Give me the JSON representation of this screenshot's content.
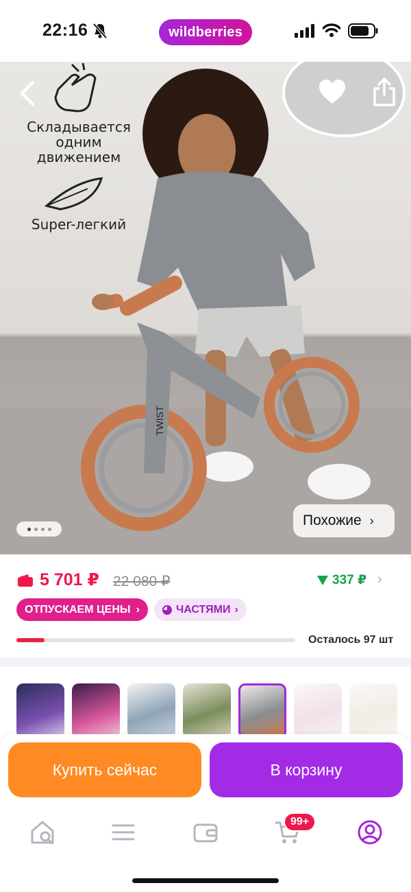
{
  "status_bar": {
    "time": "22:16",
    "brand": "wildberries"
  },
  "hero": {
    "promo_lines": [
      "Складывается",
      "одним",
      "движением",
      "Super-легкий"
    ],
    "frame_lettering": "TWIST",
    "similar_label": "Похожие",
    "pager": {
      "count": 4,
      "active_index": 0
    }
  },
  "price": {
    "current": "5 701 ₽",
    "old": "22 080 ₽",
    "cashback": "337 ₽",
    "tag_sale": "ОТПУСКАЕМ ЦЕНЫ",
    "tag_parts": "ЧАСТЯМИ",
    "stock_text": "Осталось 97 шт",
    "stock_level": 0.1
  },
  "variants": {
    "count": 7,
    "selected_index": 4
  },
  "actions": {
    "buy_now": "Купить сейчас",
    "add_to_cart": "В корзину"
  },
  "tabbar": {
    "items": [
      "home-search-icon",
      "menu-icon",
      "wallet-icon",
      "cart-icon",
      "profile-icon"
    ],
    "cart_badge": "99+",
    "active_item": "profile-icon"
  },
  "colors": {
    "brand_gradient_start": "#a626d9",
    "brand_gradient_end": "#d1139c",
    "price": "#f0184a",
    "cashback": "#17a24a",
    "buy_now": "#ff8a23",
    "add_to_cart": "#a42be6",
    "tag_sale": "#e0208b",
    "tyre": "#c87a4e"
  }
}
